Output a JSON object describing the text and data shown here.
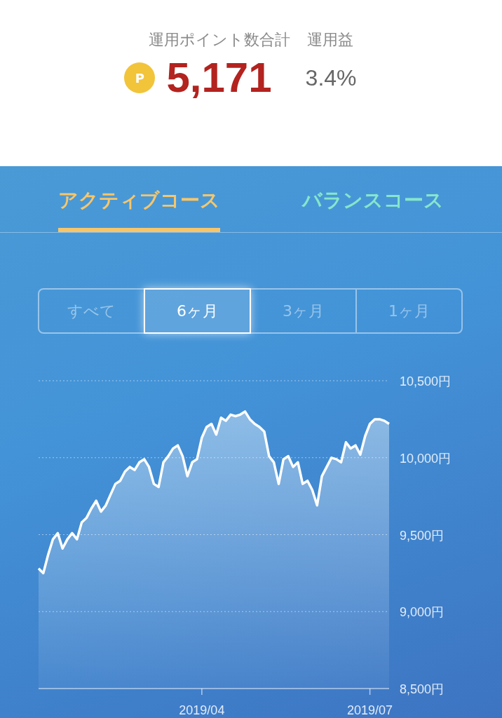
{
  "summary": {
    "points_label": "運用ポイント数合計",
    "profit_label": "運用益",
    "coin_symbol": "P",
    "points": "5,171",
    "profit": "3.4%"
  },
  "tabs": [
    {
      "label": "アクティブコース",
      "selected": true
    },
    {
      "label": "バランスコース",
      "selected": false
    }
  ],
  "periods": [
    {
      "label": "すべて",
      "selected": false
    },
    {
      "label": "6ヶ月",
      "selected": true
    },
    {
      "label": "3ヶ月",
      "selected": false
    },
    {
      "label": "1ヶ月",
      "selected": false
    }
  ],
  "chart": {
    "chart_data": {
      "type": "area",
      "grid": true,
      "ylim": [
        8500,
        10500
      ],
      "yticks": [
        {
          "value": 10500,
          "label": "10,500円"
        },
        {
          "value": 10000,
          "label": "10,000円"
        },
        {
          "value": 9500,
          "label": "9,500円"
        },
        {
          "value": 9000,
          "label": "9,000円"
        },
        {
          "value": 8500,
          "label": "8,500円"
        }
      ],
      "categories": [
        null,
        null,
        null,
        null,
        null,
        null,
        null,
        null,
        null,
        null,
        null,
        null,
        null,
        null,
        null,
        null,
        null,
        null,
        null,
        null,
        null,
        null,
        null,
        null,
        null,
        null,
        null,
        null,
        null,
        null,
        null,
        null,
        null,
        null,
        "2019/04",
        null,
        null,
        null,
        null,
        null,
        null,
        null,
        null,
        null,
        null,
        null,
        null,
        null,
        null,
        null,
        null,
        null,
        null,
        null,
        null,
        null,
        null,
        null,
        null,
        null,
        null,
        null,
        null,
        null,
        null,
        null,
        null,
        null,
        null,
        "2019/07",
        null,
        null,
        null,
        null
      ],
      "series": [
        {
          "color": "#ffffff",
          "values": [
            9280,
            9250,
            9370,
            9470,
            9510,
            9410,
            9470,
            9510,
            9470,
            9580,
            9610,
            9670,
            9720,
            9650,
            9690,
            9760,
            9830,
            9850,
            9910,
            9940,
            9920,
            9970,
            9990,
            9940,
            9830,
            9810,
            9970,
            10010,
            10060,
            10080,
            10010,
            9880,
            9970,
            9990,
            10130,
            10200,
            10220,
            10150,
            10260,
            10240,
            10280,
            10270,
            10280,
            10300,
            10250,
            10220,
            10200,
            10170,
            10010,
            9970,
            9830,
            9990,
            10010,
            9940,
            9970,
            9830,
            9850,
            9790,
            9690,
            9880,
            9940,
            10000,
            9990,
            9970,
            10100,
            10060,
            10080,
            10020,
            10140,
            10220,
            10250,
            10250,
            10240,
            10220
          ]
        }
      ]
    }
  }
}
